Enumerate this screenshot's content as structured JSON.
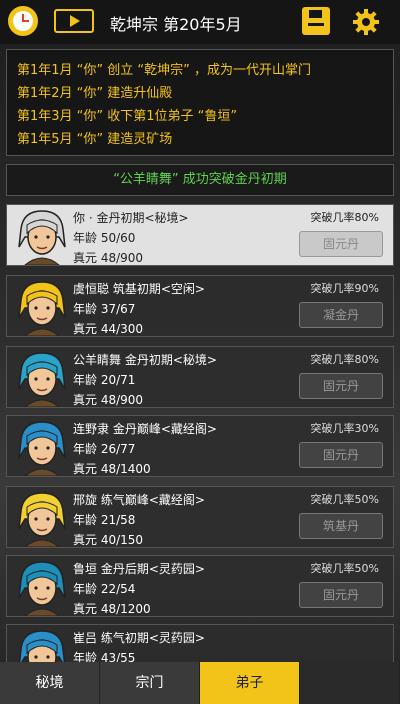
{
  "header": {
    "title": "乾坤宗 第20年5月",
    "icons": [
      "clock-icon",
      "play-icon",
      "save-icon",
      "gear-icon"
    ]
  },
  "log": [
    "第1年1月 “你” 创立 “乾坤宗” ，成为一代开山掌门",
    "第1年2月 “你” 建造升仙殿",
    "第1年3月 “你” 收下第1位弟子 “鲁垣”",
    "第1年5月 “你” 建造灵矿场"
  ],
  "notice": "“公羊睛舞” 成功突破金丹初期",
  "disciples": [
    {
      "name": "你 · 金丹初期<秘境>",
      "age": "年龄 50/60",
      "energy": "真元 48/900",
      "rate": "突破几率80%",
      "item": "固元丹",
      "hair": "#d6d6d6"
    },
    {
      "name": "虞恒聪 筑基初期<空闲>",
      "age": "年龄 37/67",
      "energy": "真元 44/300",
      "rate": "突破几率90%",
      "item": "凝金丹",
      "hair": "#f2c318"
    },
    {
      "name": "公羊睛舞 金丹初期<秘境>",
      "age": "年龄 20/71",
      "energy": "真元 48/900",
      "rate": "突破几率80%",
      "item": "固元丹",
      "hair": "#2aa3c9"
    },
    {
      "name": "连野隶 金丹巅峰<藏经阁>",
      "age": "年龄 26/77",
      "energy": "真元 48/1400",
      "rate": "突破几率30%",
      "item": "固元丹",
      "hair": "#2a8fc9"
    },
    {
      "name": "邢旋 练气巅峰<藏经阁>",
      "age": "年龄 21/58",
      "energy": "真元 40/150",
      "rate": "突破几率50%",
      "item": "筑基丹",
      "hair": "#f2d030"
    },
    {
      "name": "鲁垣 金丹后期<灵药园>",
      "age": "年龄 22/54",
      "energy": "真元 48/1200",
      "rate": "突破几率50%",
      "item": "固元丹",
      "hair": "#1e8fb8"
    },
    {
      "name": "崔吕 练气初期<灵药园>",
      "age": "年龄 43/55",
      "energy": "",
      "rate": "",
      "item": "",
      "hair": "#2a8fc9"
    }
  ],
  "tabs": [
    "秘境",
    "宗门",
    "弟子",
    ""
  ]
}
